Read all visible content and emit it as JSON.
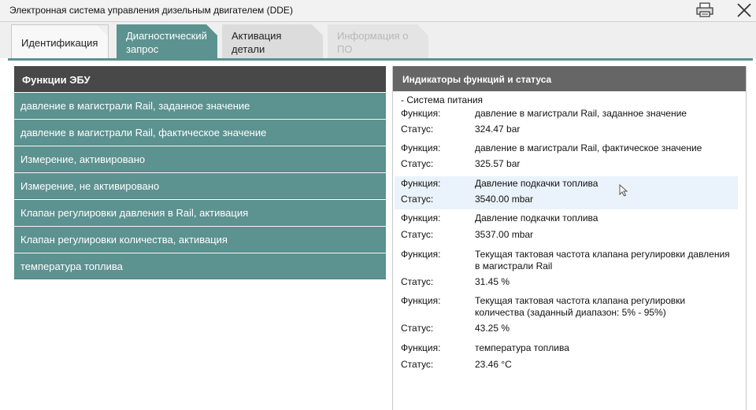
{
  "window": {
    "title": "Электронная система управления дизельным двигателем (DDE)"
  },
  "tabs": [
    {
      "label": "Идентификация"
    },
    {
      "label": "Диагностический запрос"
    },
    {
      "label": "Активация детали"
    },
    {
      "label": "Информация о ПО"
    }
  ],
  "left_panel": {
    "header": "Функции ЭБУ",
    "items": [
      "давление в магистрали Rail, заданное значение",
      "давление в магистрали Rail, фактическое значение",
      "Измерение, активировано",
      "Измерение, не активировано",
      "Клапан регулировки давления в Rail, активация",
      "Клапан регулировки количества, активация",
      "температура топлива"
    ]
  },
  "right_panel": {
    "header": "Индикаторы функций и статуса",
    "section": "- Система питания",
    "func_label": "Функция:",
    "status_label": "Статус:",
    "entries": [
      {
        "function": "давление в магистрали Rail, заданное значение",
        "status": "324.47  bar"
      },
      {
        "function": "давление в магистрали Rail, фактическое значение",
        "status": "325.57  bar"
      },
      {
        "function": "Давление подкачки топлива",
        "status": "3540.00  mbar"
      },
      {
        "function": "Давление подкачки топлива",
        "status": "3537.00  mbar"
      },
      {
        "function": "Текущая тактовая частота клапана регулировки давления в магистрали Rail",
        "status": "31.45  %"
      },
      {
        "function": "Текущая тактовая частота клапана регулировки количества (заданный диапазон: 5% - 95%)",
        "status": "43.25  %"
      },
      {
        "function": "температура топлива",
        "status": "23.46  °C"
      }
    ]
  },
  "icons": {
    "print": "printer-icon",
    "close": "close-icon",
    "cursor": "mouse-pointer-icon"
  },
  "colors": {
    "accent": "#5c9290",
    "header_dark": "#484848",
    "highlight": "#eaf3fb"
  }
}
